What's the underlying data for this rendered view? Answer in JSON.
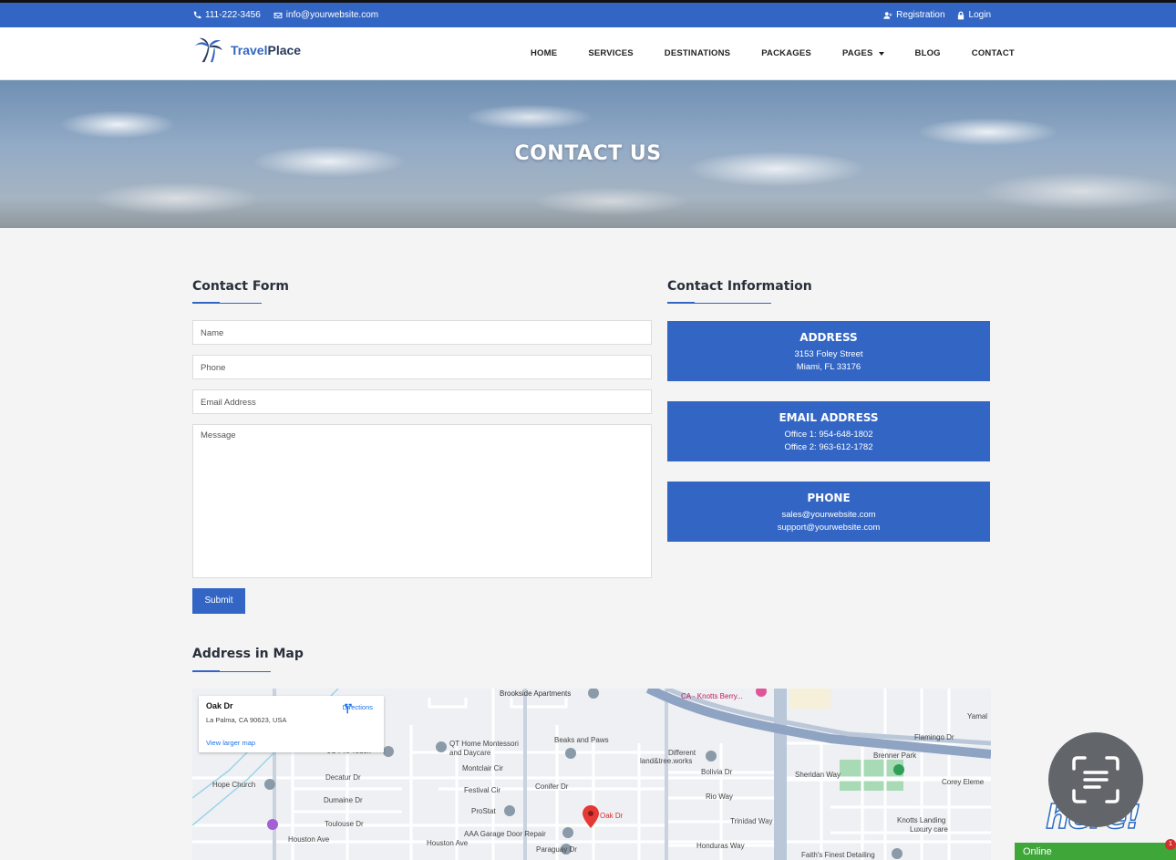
{
  "topbar": {
    "phone": "111-222-3456",
    "email": "info@yourwebsite.com",
    "registration": "Registration",
    "login": "Login"
  },
  "logo": {
    "part1": "Travel",
    "part2": "Place"
  },
  "nav": {
    "items": [
      "HOME",
      "SERVICES",
      "DESTINATIONS",
      "PACKAGES",
      "PAGES",
      "BLOG",
      "CONTACT"
    ]
  },
  "hero": {
    "title": "CONTACT US"
  },
  "contact_form": {
    "heading": "Contact Form",
    "name_placeholder": "Name",
    "phone_placeholder": "Phone",
    "email_placeholder": "Email Address",
    "message_placeholder": "Message",
    "submit": "Submit"
  },
  "contact_info": {
    "heading": "Contact Information",
    "cards": [
      {
        "title": "ADDRESS",
        "line1": "3153 Foley Street",
        "line2": "Miami, FL 33176"
      },
      {
        "title": "EMAIL ADDRESS",
        "line1": "Office 1: 954-648-1802",
        "line2": "Office 2: 963-612-1782"
      },
      {
        "title": "PHONE",
        "line1": "sales@yourwebsite.com",
        "line2": "support@yourwebsite.com"
      }
    ]
  },
  "map_section": {
    "heading": "Address in Map",
    "card": {
      "title": "Oak Dr",
      "address": "La Palma, CA 90623, USA",
      "directions": "Directions",
      "view_larger": "View larger map"
    },
    "pin_label": "Oak Dr",
    "labels": {
      "brookside": "Brookside Apartments",
      "qt_home": "QT Home Montessori",
      "daycare": "and Daycare",
      "jc_pro": "JC Pro Touch",
      "hope_church": "Hope Church",
      "decatur": "Decatur Dr",
      "dumaine": "Dumaine Dr",
      "toulouse": "Toulouse Dr",
      "houston1": "Houston Ave",
      "houston2": "Houston Ave",
      "montclair": "Montclair Cir",
      "festival": "Festival Cir",
      "prostat": "ProStat",
      "conifer": "Conifer Dr",
      "beaks": "Beaks and Paws",
      "aaa_garage": "AAA Garage Door Repair",
      "paraguay": "Paraguay Dr",
      "different": "Different",
      "land_tree": "land&tree.works",
      "bolivia": "Bolivia Dr",
      "rio": "Rio Way",
      "trinidad": "Trinidad Way",
      "honduras": "Honduras Way",
      "sheridan": "Sheridan Way",
      "flamingo": "Flamingo Dr",
      "brenner": "Brenner Park",
      "corey": "Corey Eleme",
      "knotts_landing": "Knotts Landing",
      "luxury_care": "Luxury care",
      "faiths": "Faith's Finest Detailing",
      "yamal": "Yamal",
      "knotts_berry": "CA - Knotts Berry..."
    }
  },
  "widgets": {
    "chat_status": "Online",
    "chat_badge": "1",
    "here_text": "here!"
  },
  "colors": {
    "primary": "#3366c4",
    "online_green": "#3fa63a"
  }
}
